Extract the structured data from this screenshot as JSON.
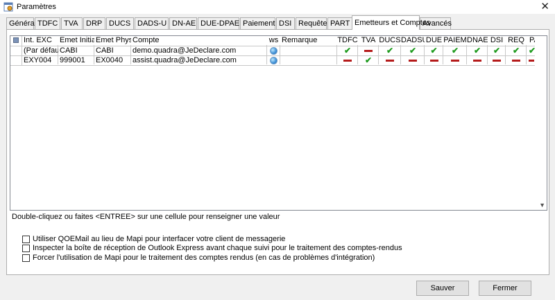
{
  "window": {
    "title": "Paramètres",
    "close_glyph": "✕"
  },
  "tabs": [
    {
      "label": "Général"
    },
    {
      "label": "TDFC"
    },
    {
      "label": "TVA"
    },
    {
      "label": "DRP"
    },
    {
      "label": "DUCS"
    },
    {
      "label": "DADS-U"
    },
    {
      "label": "DN-AE"
    },
    {
      "label": "DUE-DPAE"
    },
    {
      "label": "Paiement"
    },
    {
      "label": "DSI"
    },
    {
      "label": "Requête"
    },
    {
      "label": "PART"
    },
    {
      "label": "Emetteurs et Comptes"
    },
    {
      "label": "Avancés"
    }
  ],
  "active_tab": "Emetteurs et Comptes",
  "grid": {
    "headers": {
      "int_exc": "Int. EXC",
      "emet_initial": "Emet Initial",
      "emet_physi": "Emet Physi",
      "compte": "Compte",
      "ws": "ws",
      "remarque": "Remarque",
      "tdfc": "TDFC",
      "tva": "TVA",
      "ducs": "DUCS",
      "dadsu": "DADSU",
      "due": "DUE",
      "paiem": "PAIEM",
      "dnae": "DNAE",
      "dsi": "DSI",
      "req": "REQ",
      "pa": "PA"
    },
    "rows": [
      {
        "int_exc": "(Par défaut)",
        "emet_initial": "CABI",
        "emet_physi": "CABI",
        "compte": "demo.quadra@JeDeclare.com",
        "ws": "globe-icon",
        "flags": {
          "tdfc": "check",
          "tva": "dash",
          "ducs": "check",
          "dadsu": "check",
          "due": "check",
          "paiem": "check",
          "dnae": "check",
          "dsi": "check",
          "req": "check",
          "pa": "check"
        }
      },
      {
        "int_exc": "EXY004",
        "emet_initial": "999001",
        "emet_physi": "EX0040",
        "compte": "assist.quadra@JeDeclare.com",
        "ws": "globe-icon",
        "flags": {
          "tdfc": "dash",
          "tva": "check",
          "ducs": "dash",
          "dadsu": "dash",
          "due": "dash",
          "paiem": "dash",
          "dnae": "dash",
          "dsi": "dash",
          "req": "dash",
          "pa": "dash"
        }
      }
    ]
  },
  "hint": "Double-cliquez ou faites <ENTREE> sur une cellule pour renseigner une valeur",
  "options": [
    {
      "label": "Utiliser QOEMail au lieu de Mapi pour interfacer votre client de messagerie",
      "checked": false
    },
    {
      "label": "Inspecter la boîte de réception de Outlook Express avant chaque suivi pour le traitement des comptes-rendus",
      "checked": false
    },
    {
      "label": "Forcer l'utilisation de Mapi pour le traitement des comptes rendus (en cas de problèmes d'intégration)",
      "checked": false
    }
  ],
  "buttons": {
    "save": "Sauver",
    "close": "Fermer"
  },
  "colors": {
    "check": "#1d9a1d",
    "dash": "#b51a1a"
  }
}
